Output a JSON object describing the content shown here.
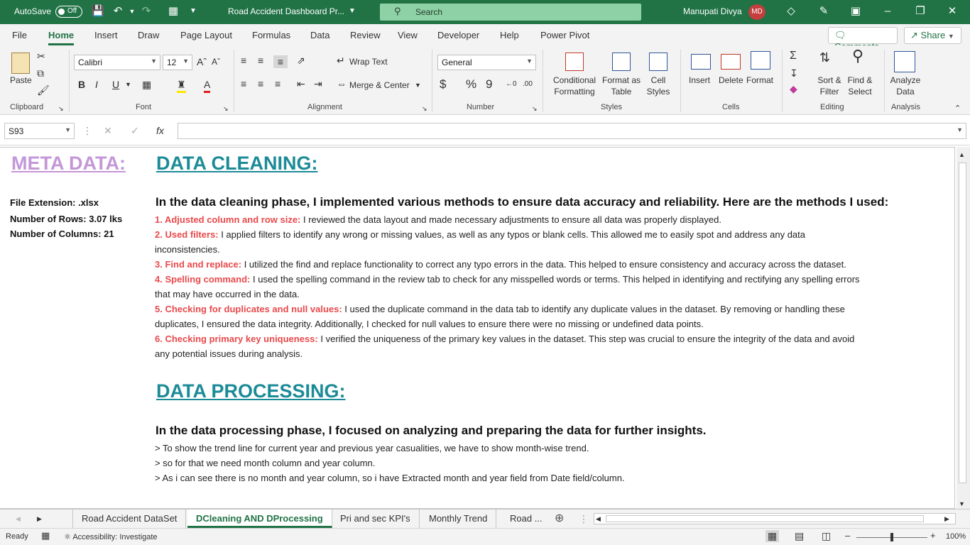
{
  "titlebar": {
    "autosave_label": "AutoSave",
    "autosave_state": "Off",
    "doc_title": "Road Accident Dashboard Pr...",
    "search_placeholder": "Search",
    "user_name": "Manupati Divya",
    "user_initials": "MD"
  },
  "menu": {
    "items": [
      "File",
      "Home",
      "Insert",
      "Draw",
      "Page Layout",
      "Formulas",
      "Data",
      "Review",
      "View",
      "Developer",
      "Help",
      "Power Pivot"
    ],
    "active": "Home",
    "comments_label": "Comments",
    "share_label": "Share"
  },
  "ribbon": {
    "clipboard": {
      "paste": "Paste",
      "label": "Clipboard"
    },
    "font": {
      "name": "Calibri",
      "size": "12",
      "bold": "B",
      "italic": "I",
      "underline": "U",
      "label": "Font"
    },
    "alignment": {
      "wrap": "Wrap Text",
      "merge": "Merge & Center",
      "label": "Alignment"
    },
    "number": {
      "format": "General",
      "currency": "$",
      "percent": "%",
      "comma": "9",
      "label": "Number"
    },
    "styles": {
      "conditional": [
        "Conditional",
        "Formatting"
      ],
      "format_table": [
        "Format as",
        "Table"
      ],
      "cell_styles": [
        "Cell",
        "Styles"
      ],
      "label": "Styles"
    },
    "cells": {
      "insert": "Insert",
      "delete": "Delete",
      "format": "Format",
      "label": "Cells"
    },
    "editing": {
      "sort": [
        "Sort &",
        "Filter"
      ],
      "find": [
        "Find &",
        "Select"
      ],
      "label": "Editing"
    },
    "analysis": {
      "analyze": [
        "Analyze",
        "Data"
      ],
      "label": "Analysis"
    }
  },
  "formula": {
    "namebox": "S93",
    "fx": "fx",
    "value": ""
  },
  "sheet": {
    "meta_heading": "META DATA:",
    "meta_lines": [
      "File Extension: .xlsx",
      "Number of Rows: 3.07 lks",
      "Number of Columns: 21"
    ],
    "cleaning_heading": "DATA CLEANING:",
    "cleaning_intro": "In the data cleaning phase, I implemented various methods to ensure data accuracy and reliability. Here are the methods I used:",
    "methods": [
      {
        "title": "1. Adjusted column and row size:",
        "lines": [
          " I reviewed the data layout and made necessary adjustments to ensure all data was properly displayed."
        ]
      },
      {
        "title": "2. Used filters:",
        "lines": [
          " I applied filters to identify any wrong or missing values, as well as any typos or blank cells. This allowed me to easily spot and address any data",
          "inconsistencies."
        ]
      },
      {
        "title": "3. Find and replace:",
        "lines": [
          " I utilized the find and replace functionality to correct any typo errors in the data. This helped to ensure consistency and accuracy across the dataset."
        ]
      },
      {
        "title": "4. Spelling command:",
        "lines": [
          " I used the spelling command in the review tab to check for any misspelled words or terms. This helped in identifying and rectifying any spelling errors",
          "that may have occurred in the data."
        ]
      },
      {
        "title": "5. Checking for duplicates and null values:",
        "lines": [
          " I used the duplicate command in the data tab to identify any duplicate values in the dataset. By removing or handling these",
          "duplicates, I ensured the data integrity. Additionally, I checked for null values to ensure there were no missing or undefined data points."
        ]
      },
      {
        "title": "6. Checking primary key uniqueness:",
        "lines": [
          " I verified the uniqueness of the primary key values in the dataset. This step was crucial to ensure the integrity of the data and avoid",
          "any potential issues during analysis."
        ]
      }
    ],
    "processing_heading": "DATA PROCESSING:",
    "processing_intro": "In the data processing phase, I focused on analyzing and preparing the data for further insights.",
    "processing_lines": [
      "> To show the trend line for current year and previous year casualities, we have to show month-wise trend.",
      "> so for that we need month column and year column.",
      "> As i can see there is no month and year column, so i have Extracted month and year field from Date field/column."
    ]
  },
  "tabs": {
    "items": [
      "Road Accident DataSet",
      "DCleaning AND DProcessing",
      "Pri and sec KPI's",
      "Monthly Trend",
      "Road ..."
    ],
    "active": "DCleaning AND DProcessing"
  },
  "status": {
    "ready": "Ready",
    "accessibility": "Accessibility: Investigate",
    "zoom": "100%"
  },
  "colors": {
    "excel_green": "#217346",
    "meta_purple": "#c497d8",
    "teal": "#1c8b98",
    "method_red": "#e9494b"
  }
}
